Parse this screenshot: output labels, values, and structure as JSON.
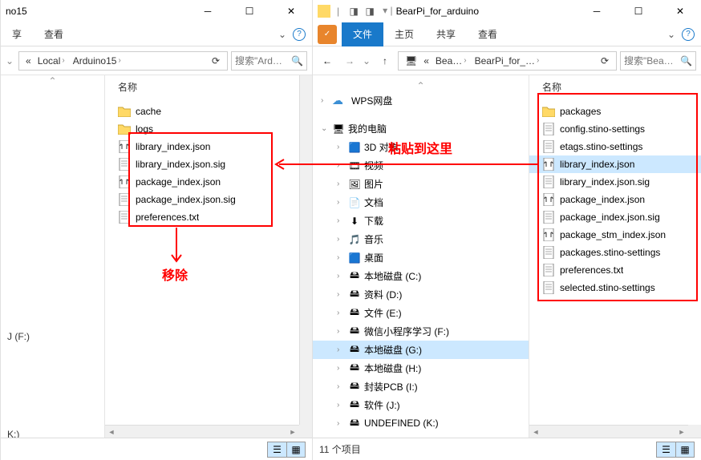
{
  "window_left": {
    "title_folder": "no15",
    "tabs": {
      "share": "享",
      "view": "查看"
    },
    "breadcrumb": {
      "prefix": "«",
      "segments": [
        "Local",
        "Arduino15"
      ]
    },
    "search": {
      "placeholder": "搜索\"Ard…"
    },
    "column_header": "名称",
    "sidebar_items": [
      "J (F:)"
    ],
    "sidebar_items2": [
      "K:)"
    ],
    "files": [
      {
        "name": "cache",
        "type": "folder"
      },
      {
        "name": "logs",
        "type": "folder"
      },
      {
        "name": "library_index.json",
        "type": "json"
      },
      {
        "name": "library_index.json.sig",
        "type": "file"
      },
      {
        "name": "package_index.json",
        "type": "json"
      },
      {
        "name": "package_index.json.sig",
        "type": "file"
      },
      {
        "name": "preferences.txt",
        "type": "file"
      }
    ]
  },
  "window_right": {
    "title_folder": "BearPi_for_arduino",
    "tabs": {
      "file": "文件",
      "home": "主页",
      "share": "共享",
      "view": "查看"
    },
    "breadcrumb": {
      "prefix": "«",
      "segments": [
        "Bea…",
        "BearPi_for_…"
      ]
    },
    "search": {
      "placeholder": "搜索\"Bea…"
    },
    "column_header": "名称",
    "tree": {
      "wps": "WPS网盘",
      "mypc": "我的电脑",
      "items": [
        {
          "label": "3D 对象",
          "icon": "3d"
        },
        {
          "label": "视频",
          "icon": "video"
        },
        {
          "label": "图片",
          "icon": "picture"
        },
        {
          "label": "文档",
          "icon": "document"
        },
        {
          "label": "下载",
          "icon": "download"
        },
        {
          "label": "音乐",
          "icon": "music"
        },
        {
          "label": "桌面",
          "icon": "desktop"
        },
        {
          "label": "本地磁盘 (C:)",
          "icon": "drive"
        },
        {
          "label": "资料 (D:)",
          "icon": "drive"
        },
        {
          "label": "文件 (E:)",
          "icon": "drive"
        },
        {
          "label": "微信小程序学习 (F:)",
          "icon": "drive"
        },
        {
          "label": "本地磁盘 (G:)",
          "icon": "drive",
          "selected": true
        },
        {
          "label": "本地磁盘 (H:)",
          "icon": "drive"
        },
        {
          "label": "封装PCB (I:)",
          "icon": "drive"
        },
        {
          "label": "软件 (J:)",
          "icon": "drive"
        },
        {
          "label": "UNDEFINED (K:)",
          "icon": "drive"
        }
      ]
    },
    "files": [
      {
        "name": "packages",
        "type": "folder"
      },
      {
        "name": "config.stino-settings",
        "type": "file"
      },
      {
        "name": "etags.stino-settings",
        "type": "file"
      },
      {
        "name": "library_index.json",
        "type": "json",
        "selected": true
      },
      {
        "name": "library_index.json.sig",
        "type": "file"
      },
      {
        "name": "package_index.json",
        "type": "json"
      },
      {
        "name": "package_index.json.sig",
        "type": "file"
      },
      {
        "name": "package_stm_index.json",
        "type": "json"
      },
      {
        "name": "packages.stino-settings",
        "type": "file"
      },
      {
        "name": "preferences.txt",
        "type": "file"
      },
      {
        "name": "selected.stino-settings",
        "type": "file"
      }
    ],
    "status": "11 个项目"
  },
  "annotations": {
    "remove": "移除",
    "paste": "粘贴到这里"
  }
}
